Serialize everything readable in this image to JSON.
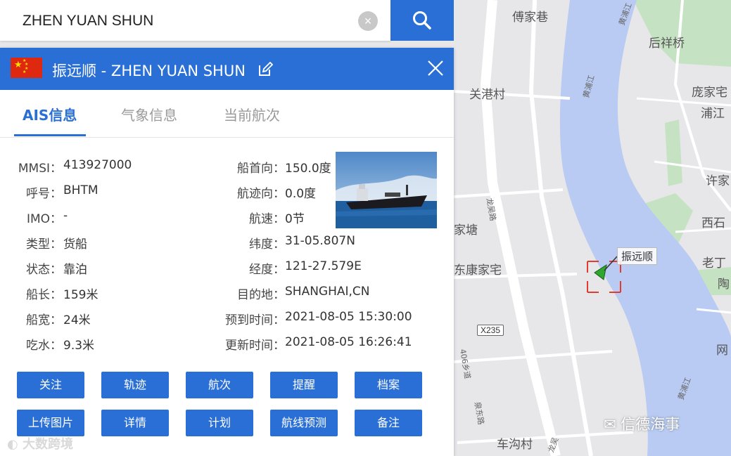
{
  "search": {
    "query": "ZHEN YUAN SHUN",
    "clear_symbol": "×"
  },
  "header": {
    "title": "振远顺 -  ZHEN YUAN SHUN",
    "flag": "china-flag"
  },
  "tabs": [
    {
      "label": "AIS信息",
      "active": true
    },
    {
      "label": "气象信息",
      "active": false
    },
    {
      "label": "当前航次",
      "active": false
    }
  ],
  "info_left": [
    {
      "label": "MMSI：",
      "value": "413927000"
    },
    {
      "label": "呼号：",
      "value": "BHTM"
    },
    {
      "label": "IMO：",
      "value": "-"
    },
    {
      "label": "类型：",
      "value": "货船"
    },
    {
      "label": "状态：",
      "value": "靠泊"
    },
    {
      "label": "船长：",
      "value": "159米"
    },
    {
      "label": "船宽：",
      "value": "24米"
    },
    {
      "label": "吃水：",
      "value": "9.3米"
    }
  ],
  "info_right": [
    {
      "label": "船首向：",
      "value": "150.0度"
    },
    {
      "label": "航迹向：",
      "value": "0.0度"
    },
    {
      "label": "航速：",
      "value": "0节"
    },
    {
      "label": "纬度：",
      "value": "31-05.807N"
    },
    {
      "label": "经度：",
      "value": "121-27.579E"
    },
    {
      "label": "目的地：",
      "value": "SHANGHAI,CN"
    },
    {
      "label": "预到时间：",
      "value": "2021-08-05 15:30:00"
    },
    {
      "label": "更新时间：",
      "value": "2021-08-05 16:26:41"
    }
  ],
  "actions_row1": [
    "关注",
    "轨迹",
    "航次",
    "提醒",
    "档案"
  ],
  "actions_row2": [
    "上传图片",
    "详情",
    "计划",
    "航线预测",
    "备注"
  ],
  "map": {
    "labels": [
      "傅家巷",
      "后祥桥",
      "关港村",
      "庞家宅",
      "浦江",
      "许家",
      "西石",
      "老丁",
      "陶",
      "家塘",
      "东康家宅",
      "网",
      "车沟村",
      "黄浦江",
      "黄浦江",
      "黄浦江",
      "龙吴路",
      "406乡道",
      "泉东路",
      "龙吴"
    ],
    "road_badge": "X235",
    "ship_label": "振远顺",
    "colors": {
      "water": "#b9cbf2",
      "land": "#e7e7ea",
      "green": "#c5e3c2",
      "road": "#ffffff"
    }
  },
  "watermarks": {
    "left": "大数跨境",
    "right": "信德海事"
  },
  "colors": {
    "accent": "#2a6fd6",
    "flag_red": "#de2910",
    "flag_yellow": "#ffde00"
  }
}
